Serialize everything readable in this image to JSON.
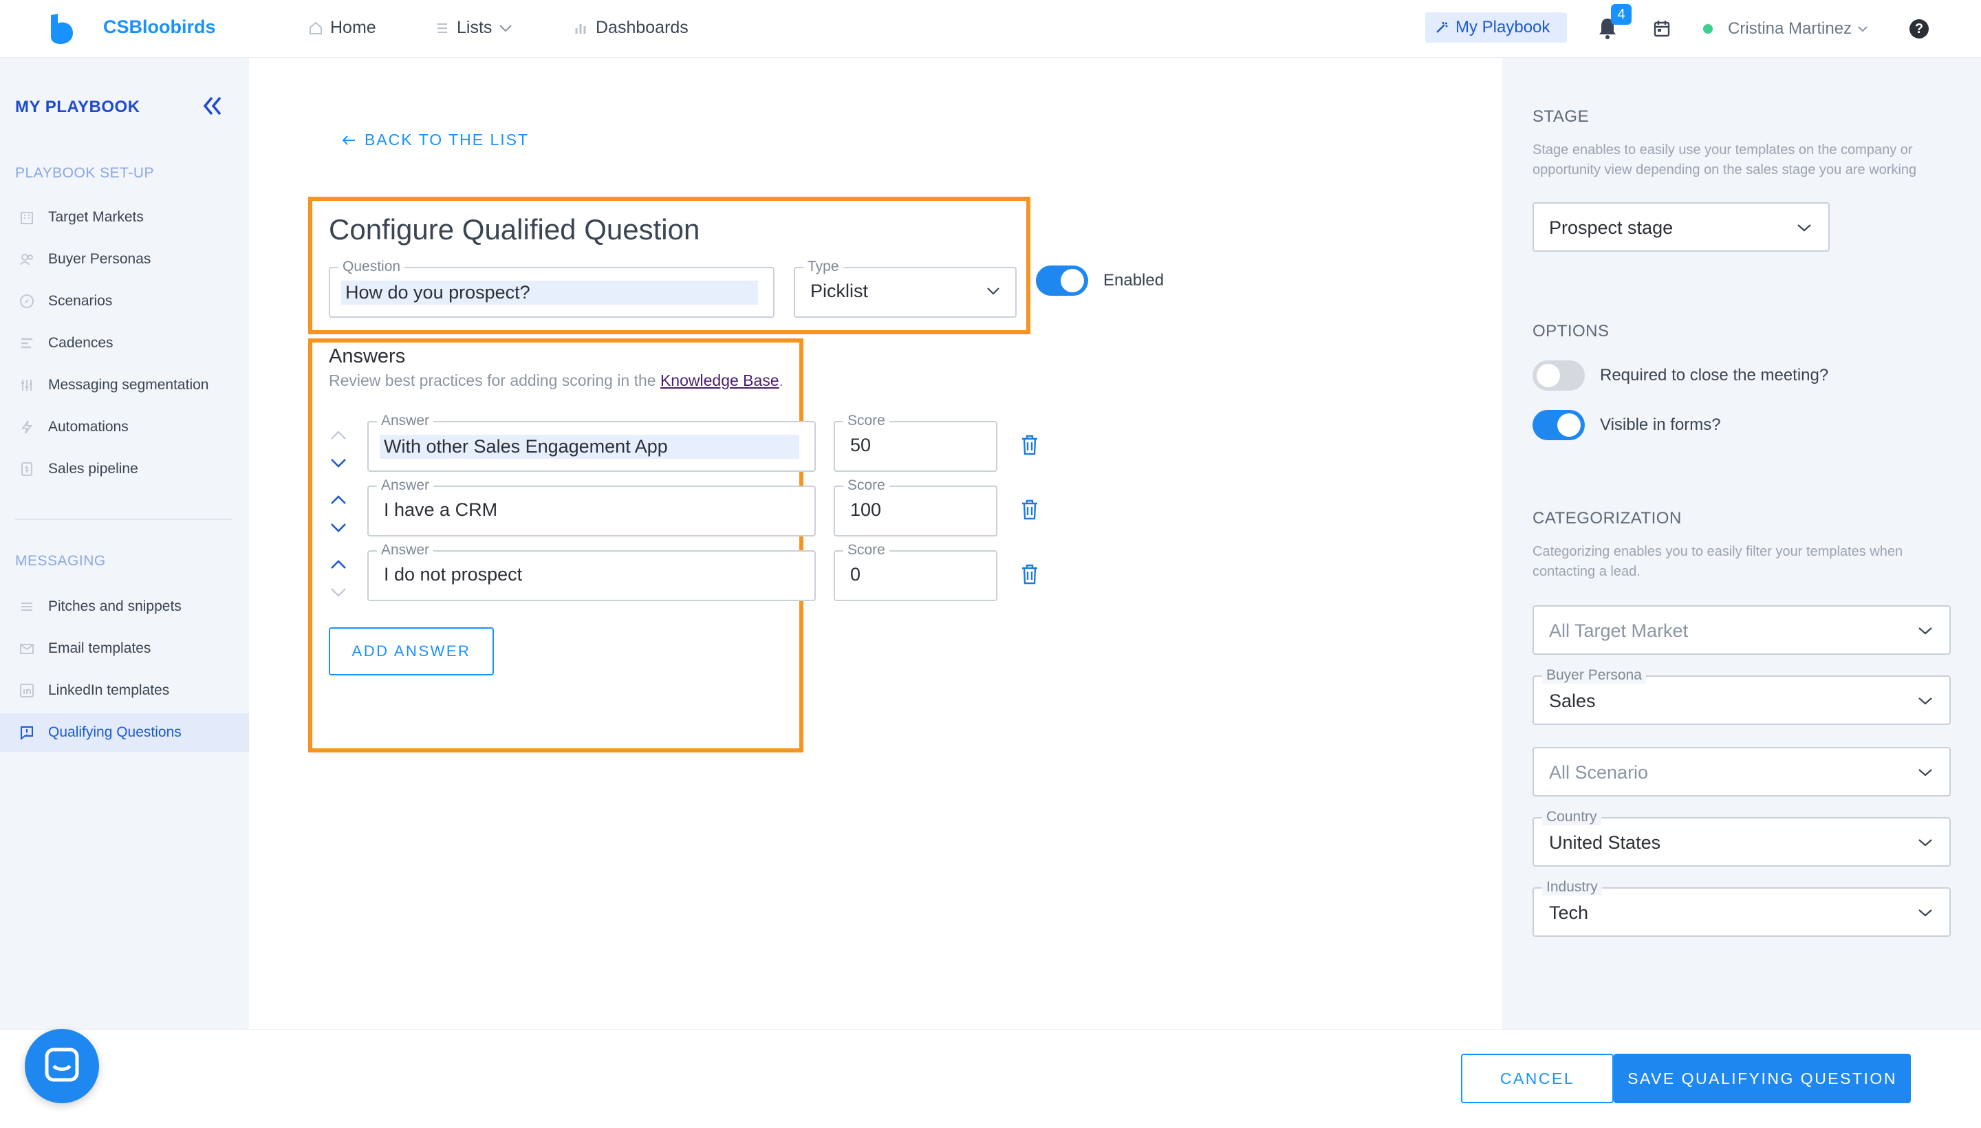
{
  "header": {
    "brand": "CSBloobirds",
    "nav": [
      {
        "label": "Home",
        "icon": "home-icon"
      },
      {
        "label": "Lists",
        "icon": "list-icon"
      },
      {
        "label": "Dashboards",
        "icon": "chart-icon"
      }
    ],
    "my_playbook": "My Playbook",
    "notifications_count": "4",
    "user_name": "Cristina Martinez",
    "help": "?"
  },
  "sidebar": {
    "title": "MY PLAYBOOK",
    "section_setup": "PLAYBOOK SET-UP",
    "setup_items": [
      {
        "label": "Target Markets"
      },
      {
        "label": "Buyer Personas"
      },
      {
        "label": "Scenarios"
      },
      {
        "label": "Cadences"
      },
      {
        "label": "Messaging segmentation"
      },
      {
        "label": "Automations"
      },
      {
        "label": "Sales pipeline"
      }
    ],
    "section_messaging": "MESSAGING",
    "messaging_items": [
      {
        "label": "Pitches and snippets"
      },
      {
        "label": "Email templates"
      },
      {
        "label": "LinkedIn templates"
      },
      {
        "label": "Qualifying Questions"
      }
    ]
  },
  "main": {
    "back_label": "BACK TO THE LIST",
    "title": "Configure Qualified Question",
    "question_label": "Question",
    "question_value": "How do you prospect?",
    "type_label": "Type",
    "type_value": "Picklist",
    "enabled_label": "Enabled",
    "enabled": true,
    "answers_title": "Answers",
    "answers_help": "Review best practices for adding scoring in the ",
    "answers_help_link": "Knowledge Base",
    "answers_help_end": ".",
    "answer_label": "Answer",
    "score_label": "Score",
    "answers": [
      {
        "answer": "With other Sales Engagement App",
        "score": "50"
      },
      {
        "answer": "I have a CRM",
        "score": "100"
      },
      {
        "answer": "I do not prospect",
        "score": "0"
      }
    ],
    "add_answer": "ADD ANSWER"
  },
  "panel": {
    "stage_heading": "STAGE",
    "stage_help": "Stage enables to easily use your templates on the company or opportunity view depending on the sales stage you are working",
    "stage_value": "Prospect stage",
    "options_heading": "OPTIONS",
    "required_label": "Required to close the meeting?",
    "required": false,
    "visible_label": "Visible in forms?",
    "visible": true,
    "categorization_heading": "CATEGORIZATION",
    "categorization_help": "Categorizing enables you to easily filter your templates when contacting a lead.",
    "target_market_placeholder": "All Target Market",
    "buyer_persona_label": "Buyer Persona",
    "buyer_persona_value": "Sales",
    "scenario_placeholder": "All Scenario",
    "country_label": "Country",
    "country_value": "United States",
    "industry_label": "Industry",
    "industry_value": "Tech"
  },
  "footer": {
    "cancel": "CANCEL",
    "save": "SAVE QUALIFYING QUESTION"
  },
  "colors": {
    "brand": "#1991ff",
    "highlight": "#f7931e",
    "toggle_on": "#1e87f0"
  }
}
